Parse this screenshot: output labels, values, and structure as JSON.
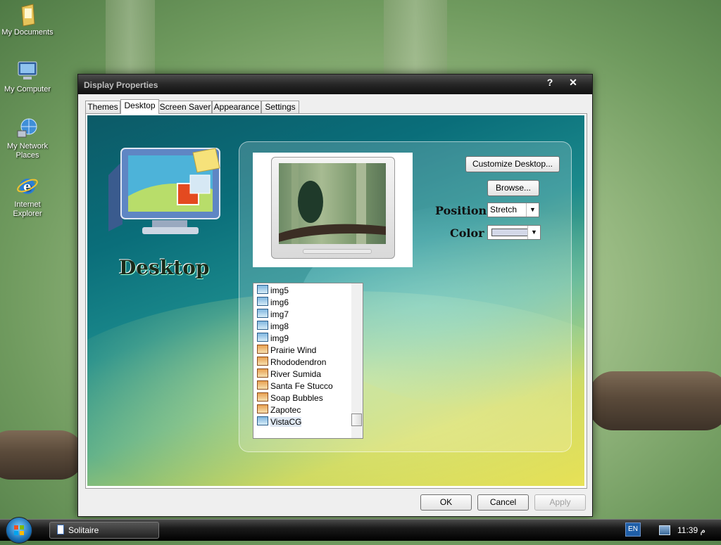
{
  "desktop_icons": [
    {
      "label": "My Documents",
      "icon": "folder-icon"
    },
    {
      "label": "My Computer",
      "icon": "computer-icon"
    },
    {
      "label": "My Network Places",
      "icon": "network-icon"
    },
    {
      "label": "Internet Explorer",
      "icon": "ie-icon"
    }
  ],
  "window": {
    "title": "Display Properties",
    "help_label": "?",
    "close_label": "✕",
    "tabs": [
      {
        "label": "Themes"
      },
      {
        "label": "Desktop",
        "active": true
      },
      {
        "label": "Screen Saver"
      },
      {
        "label": "Appearance"
      },
      {
        "label": "Settings"
      }
    ],
    "section_heading": "Desktop",
    "customize_label": "Customize Desktop...",
    "browse_label": "Browse...",
    "position_label": "Position :",
    "position_value": "Stretch",
    "color_label": "Color :",
    "color_value": "#d3d8e8",
    "backgrounds": [
      {
        "label": "img5",
        "icon": "picture-icon"
      },
      {
        "label": "img6",
        "icon": "picture-icon"
      },
      {
        "label": "img7",
        "icon": "picture-icon"
      },
      {
        "label": "img8",
        "icon": "picture-icon"
      },
      {
        "label": "img9",
        "icon": "picture-icon"
      },
      {
        "label": "Prairie Wind",
        "icon": "wallpaper-icon"
      },
      {
        "label": "Rhododendron",
        "icon": "wallpaper-icon"
      },
      {
        "label": "River Sumida",
        "icon": "wallpaper-icon"
      },
      {
        "label": "Santa Fe Stucco",
        "icon": "wallpaper-icon"
      },
      {
        "label": "Soap Bubbles",
        "icon": "wallpaper-icon"
      },
      {
        "label": "Zapotec",
        "icon": "wallpaper-icon"
      },
      {
        "label": "VistaCG",
        "icon": "picture-icon",
        "selected": true
      }
    ],
    "ok_label": "OK",
    "cancel_label": "Cancel",
    "apply_label": "Apply"
  },
  "taskbar": {
    "task_label": "Solitaire",
    "language": "EN",
    "clock": "11:39 م"
  }
}
